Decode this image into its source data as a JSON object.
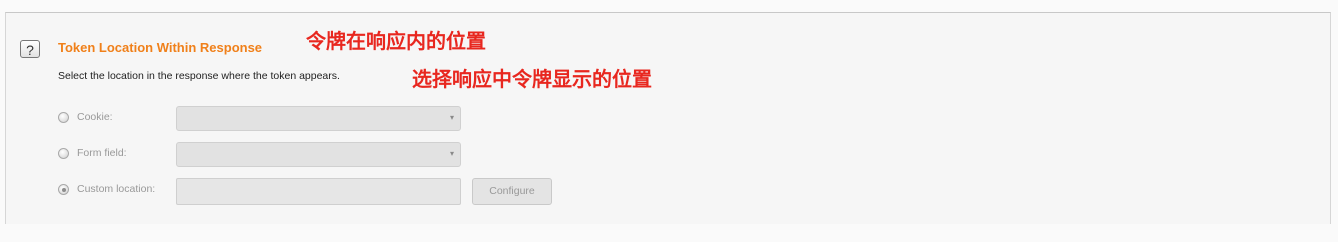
{
  "section": {
    "help_icon": "?",
    "title": "Token Location Within Response",
    "description": "Select the location in the response where the token appears."
  },
  "annotations": {
    "title_note": "令牌在响应内的位置",
    "description_note": "选择响应中令牌显示的位置"
  },
  "options": {
    "cookie": {
      "label": "Cookie:",
      "selected": false,
      "dropdown_value": "",
      "chevron": "▾"
    },
    "form_field": {
      "label": "Form field:",
      "selected": false,
      "dropdown_value": "",
      "chevron": "▾"
    },
    "custom_location": {
      "label": "Custom location:",
      "selected": true,
      "input_value": "",
      "button_label": "Configure"
    }
  },
  "colors": {
    "title": "#f0801a",
    "annotation": "#e8271f",
    "disabled_text": "#999999"
  }
}
